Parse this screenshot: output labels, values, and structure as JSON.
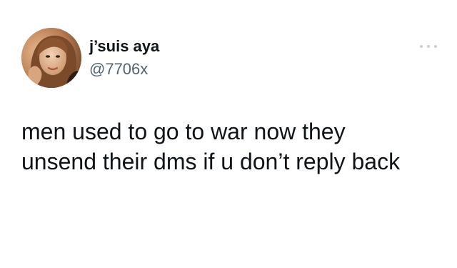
{
  "author": {
    "display_name": "j’suis aya",
    "handle": "@7706x",
    "avatar_icon": "profile-photo"
  },
  "menu": {
    "icon": "more-options-icon"
  },
  "tweet": {
    "lines": [
      "men used to go to war now they",
      "unsend their dms if u don’t reply back"
    ]
  },
  "colors": {
    "background": "#ffffff",
    "text_primary": "#0f1419",
    "text_secondary": "#536471",
    "menu_dots": "#c7ced4"
  }
}
